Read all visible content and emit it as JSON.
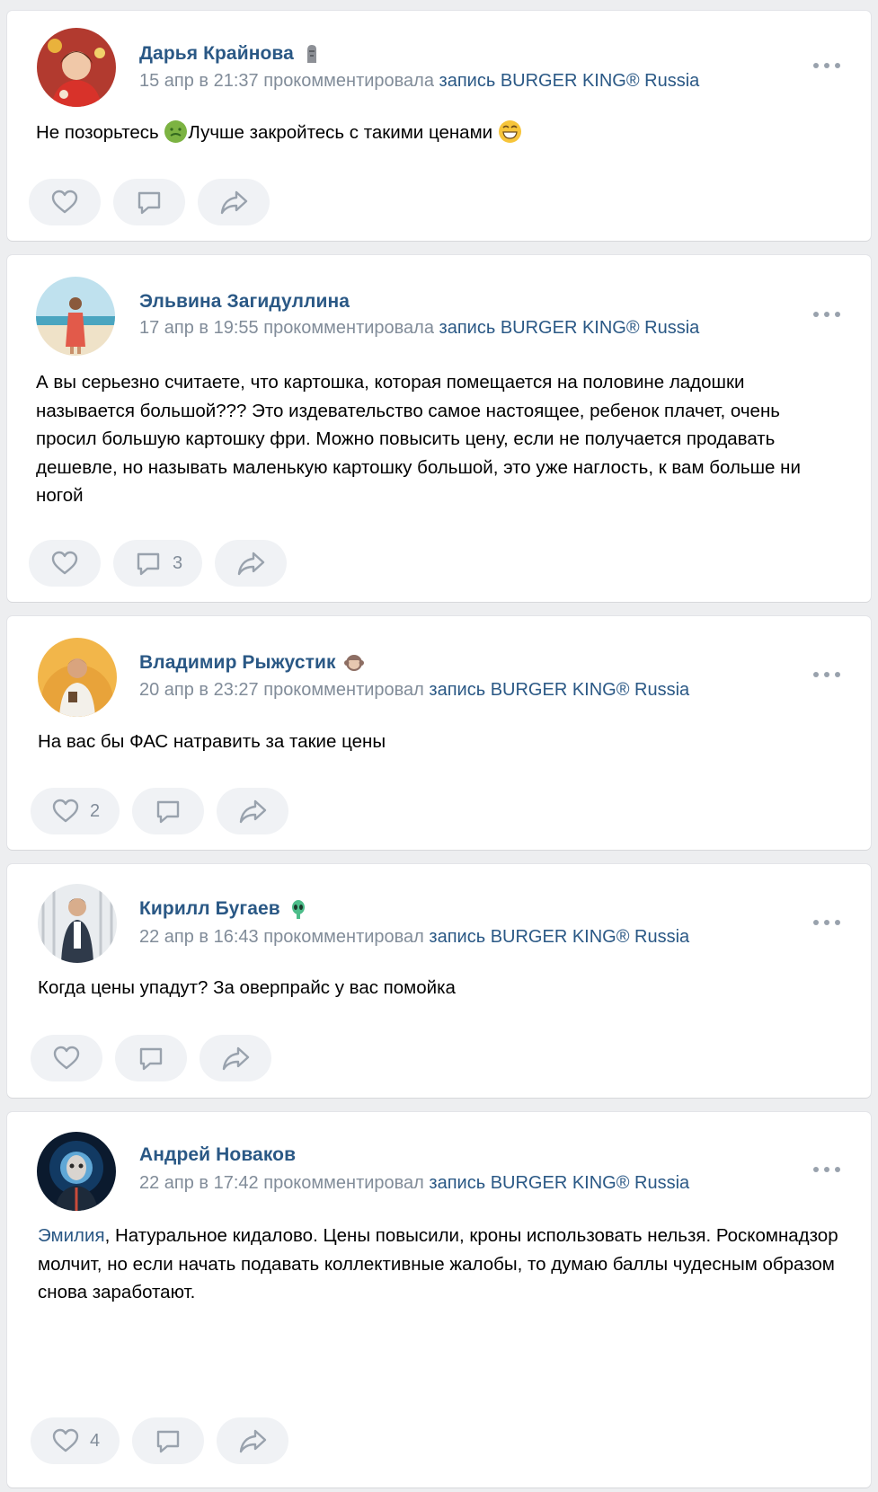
{
  "posts": [
    {
      "author": "Дарья Крайнова",
      "date": "15 апр в 21:37",
      "action": "прокомментировала",
      "target": "запись BURGER KING® Russia",
      "status_icon": "moai-icon",
      "text_part1": "Не позорьтесь ",
      "text_part2": "Лучше закройтесь с такими ценами ",
      "inline_icons": [
        "nauseated-face-icon",
        "grinning-face-icon"
      ],
      "likes": "",
      "comments": ""
    },
    {
      "author": "Эльвина Загидуллина",
      "date": "17 апр в 19:55",
      "action": "прокомментировала",
      "target": "запись BURGER KING® Russia",
      "text": "А вы серьезно считаете, что картошка, которая помещается на половине ладошки называется большой??? Это издевательство самое настоящее, ребенок плачет, очень просил большую картошку фри. Можно повысить цену, если не получается продавать дешевле, но называть маленькую картошку большой, это уже наглость, к вам больше ни ногой",
      "likes": "",
      "comments": "3"
    },
    {
      "author": "Владимир Рыжустик",
      "date": "20 апр в 23:27",
      "action": "прокомментировал",
      "target": "запись BURGER KING® Russia",
      "status_icon": "monkey-icon",
      "text": "На вас бы ФАС натравить за такие цены",
      "likes": "2",
      "comments": ""
    },
    {
      "author": "Кирилл Бугаев",
      "date": "22 апр в 16:43",
      "action": "прокомментировал",
      "target": "запись BURGER KING® Russia",
      "status_icon": "alien-icon",
      "text": "Когда цены упадут? За оверпрайс у вас помойка",
      "likes": "",
      "comments": ""
    },
    {
      "author": "Андрей Новаков",
      "date": "22 апр в 17:42",
      "action": "прокомментировал",
      "target": "запись BURGER KING® Russia",
      "mention": "Эмилия",
      "text": ", Натуральное кидалово. Цены повысили, кроны использовать нельзя. Роскомнадзор молчит, но если начать подавать коллективные жалобы, то думаю баллы чудесным образом снова заработают.",
      "likes": "4",
      "comments": ""
    }
  ],
  "colors": {
    "link": "#2a5885",
    "meta": "#818c99",
    "pill": "#f0f2f5",
    "background": "#edeef0"
  }
}
